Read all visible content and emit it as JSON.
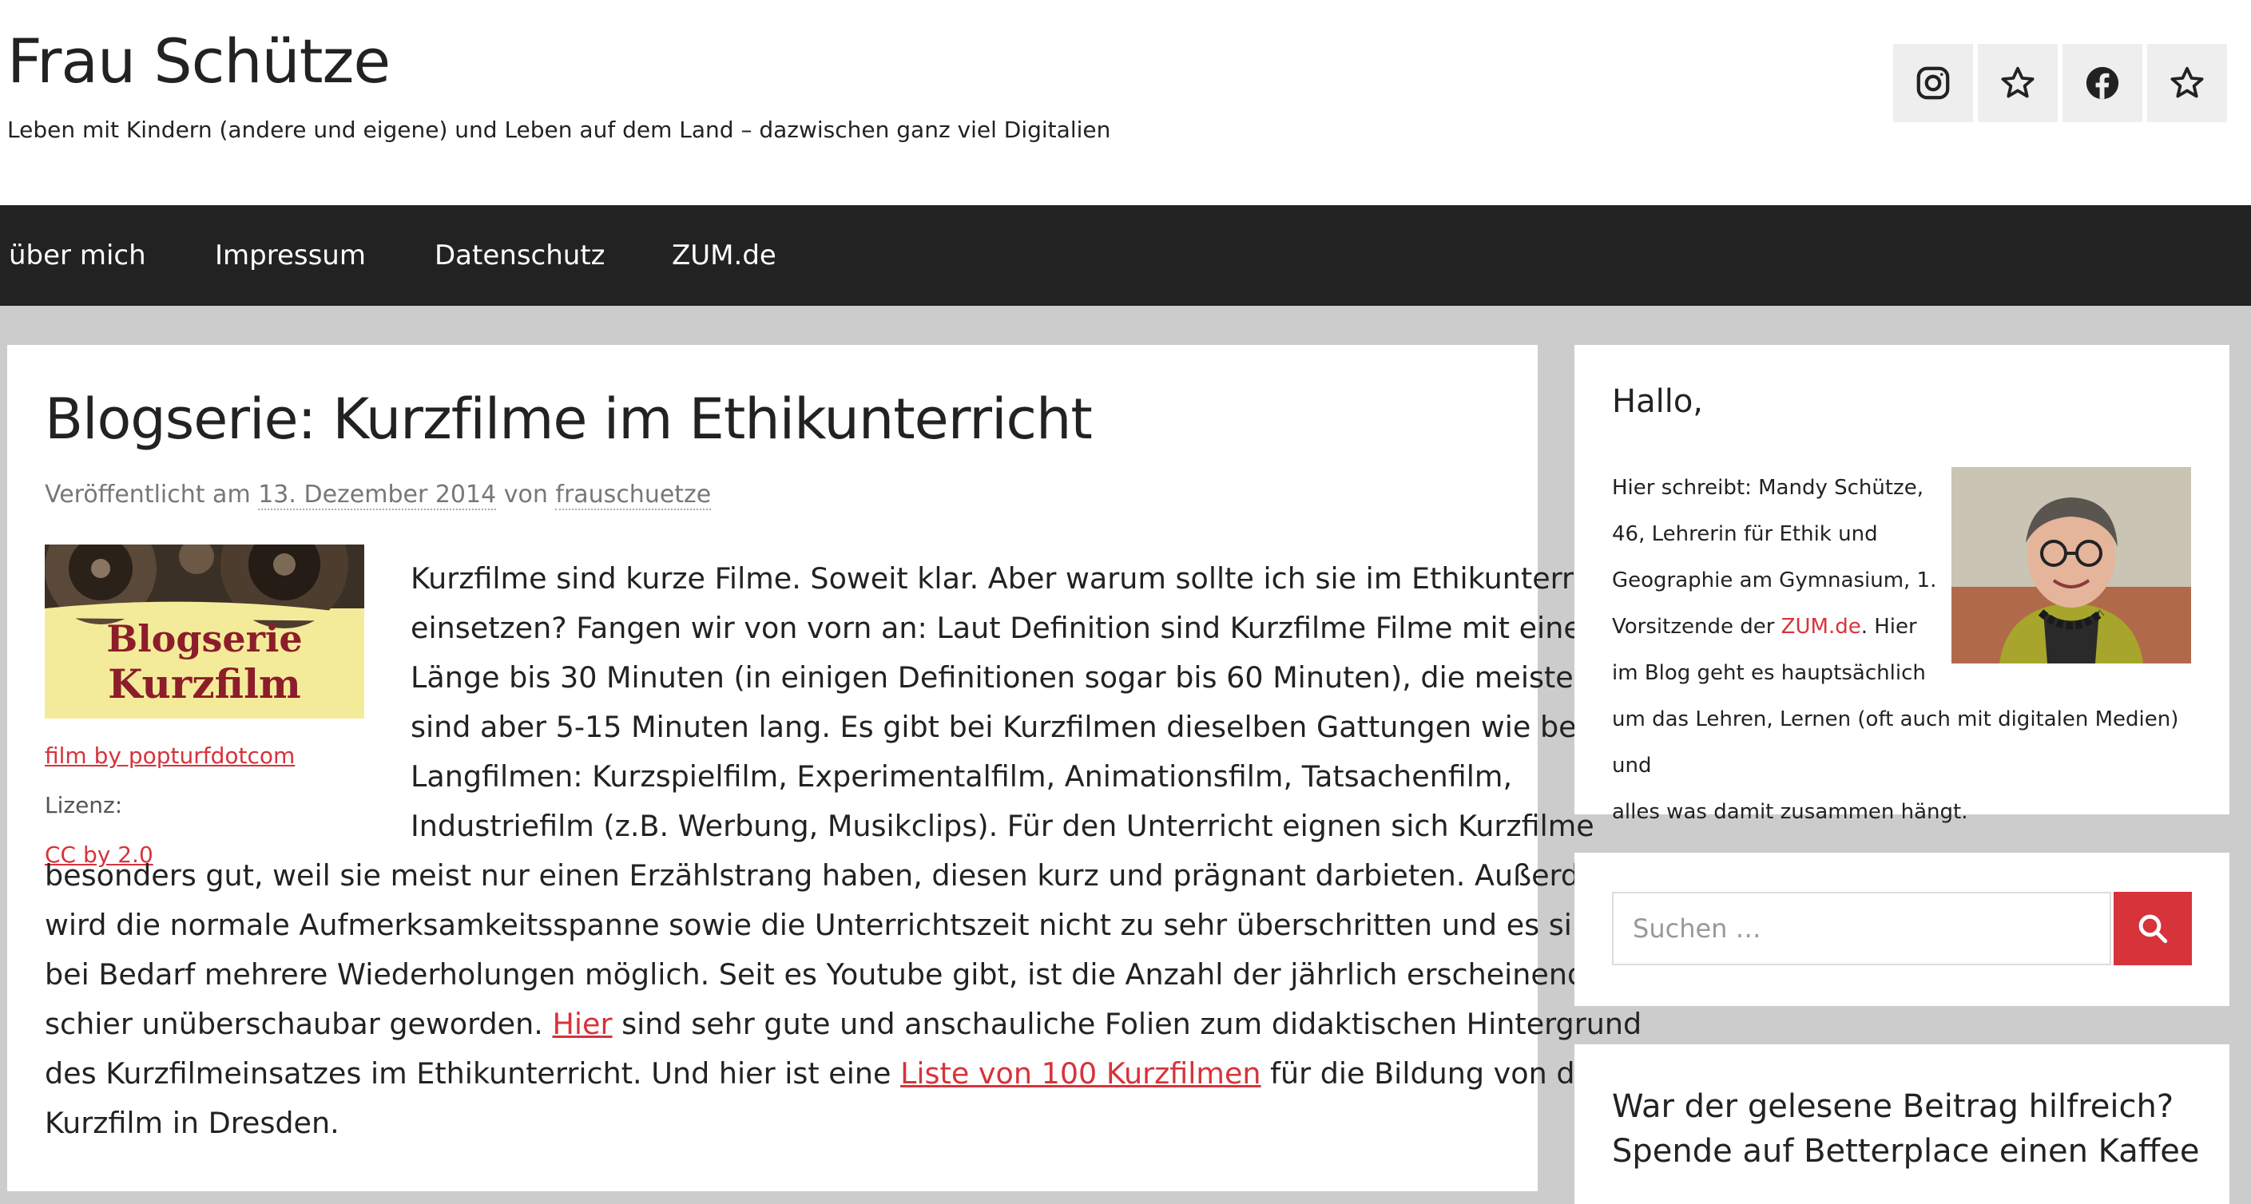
{
  "header": {
    "site_title": "Frau Schütze",
    "site_description": "Leben mit Kindern (andere und eigene) und Leben auf dem Land – dazwischen ganz viel Digitalien",
    "social": [
      {
        "name": "instagram-icon"
      },
      {
        "name": "star-icon"
      },
      {
        "name": "facebook-icon"
      },
      {
        "name": "star-icon"
      }
    ]
  },
  "nav": {
    "items": [
      "über mich",
      "Impressum",
      "Datenschutz",
      "ZUM.de"
    ]
  },
  "post": {
    "title": "Blogserie: Kurzfilme im Ethikunterricht",
    "meta_prefix": "Veröffentlicht am",
    "date": "13. Dezember 2014",
    "by": "von",
    "author": "frauschuetze",
    "image_text_1": "Blogserie",
    "image_text_2": "Kurzfilm",
    "caption_link": "film by popturfdotcom",
    "caption_license": "Lizenz:",
    "caption_license_link": "CC by 2.0",
    "lines": [
      "Kurzfilme sind kurze Filme. Soweit klar. Aber warum sollte ich sie im Ethikunterricht",
      "einsetzen? Fangen wir von vorn an: Laut Definition sind Kurzfilme Filme mit einer",
      "Länge bis 30 Minuten (in einigen Definitionen sogar bis 60 Minuten), die meisten",
      "sind aber 5-15 Minuten lang. Es gibt bei Kurzfilmen dieselben Gattungen wie bei",
      "Langfilmen: Kurzspielfilm, Experimentalfilm, Animationsfilm, Tatsachenfilm,",
      "Industriefilm (z.B. Werbung, Musikclips). Für den Unterricht eignen sich Kurzfilme",
      "besonders gut, weil sie meist nur einen Erzählstrang haben, diesen kurz und prägnant darbieten. Außerdem",
      "wird die normale Aufmerksamkeitsspanne sowie die Unterrichtszeit nicht zu sehr überschritten und es sind",
      "bei Bedarf mehrere Wiederholungen möglich. Seit es Youtube gibt, ist die Anzahl der jährlich erscheinenden"
    ],
    "line10_a": "schier unüberschaubar geworden.",
    "line10_link": "Hier",
    "line10_b": "sind sehr gute und anschauliche Folien zum didaktischen Hintergrund",
    "line11_a": "des Kurzfilmeinsatzes im Ethikunterricht. Und hier ist eine",
    "line11_link": "Liste von 100 Kurzfilmen",
    "line11_b": "für die Bildung von der AG",
    "line12": "Kurzfilm in Dresden."
  },
  "sidebar": {
    "about": {
      "title": "Hallo,",
      "text_a": "Hier schreibt: Mandy Schütze,",
      "text_b": "46, Lehrerin für Ethik und",
      "text_c": "Geographie am Gymnasium, 1.",
      "text_d": "Vorsitzende der",
      "link": "ZUM.de",
      "text_e": ". Hier",
      "text_f": "im Blog geht es hauptsächlich",
      "text_g": "um das Lehren, Lernen (oft auch mit digitalen Medien) und",
      "text_h": "alles was damit zusammen hängt."
    },
    "search": {
      "placeholder": "Suchen …"
    },
    "donate": {
      "title": "War der gelesene Beitrag hilfreich? Spende auf Betterplace einen Kaffee"
    }
  },
  "colors": {
    "accent": "#d7333b",
    "nav_bg": "#222222",
    "page_bg": "#cccccc"
  }
}
